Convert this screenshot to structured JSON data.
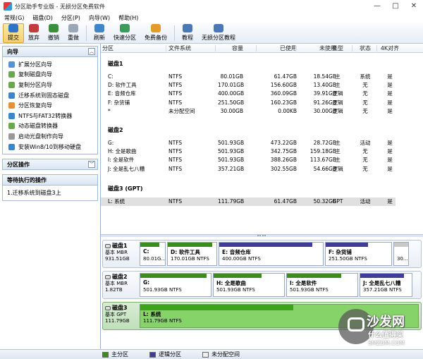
{
  "window": {
    "title": "分区助手专业版 - 无损分区免费软件",
    "controls": [
      "—",
      "□",
      "✕"
    ]
  },
  "menu": [
    "常规(G)",
    "磁盘(D)",
    "分区(P)",
    "向导(W)",
    "帮助(H)"
  ],
  "toolbar": [
    {
      "label": "提交",
      "icon": "commit-icon",
      "color": "#2d73c9",
      "active": true
    },
    {
      "label": "放弃",
      "icon": "discard-icon",
      "color": "#c33c3c"
    },
    {
      "label": "撤销",
      "icon": "undo-icon",
      "color": "#3a8f3a"
    },
    {
      "label": "重做",
      "icon": "redo-icon",
      "color": "#9aa7b8"
    },
    {
      "label": "刷新",
      "icon": "refresh-icon",
      "color": "#3f86c9"
    },
    {
      "label": "快速分区",
      "icon": "quick-partition-icon",
      "color": "#3c9a5b"
    },
    {
      "label": "免费备份",
      "icon": "backup-icon",
      "color": "#e39b2b"
    },
    {
      "label": "教程",
      "icon": "tutorial-icon",
      "color": "#4a78b6"
    },
    {
      "label": "无损分区教程",
      "icon": "lossless-tutorial-icon",
      "color": "#4a78b6"
    }
  ],
  "sidebar": {
    "wizard_title": "向导",
    "wizards": [
      {
        "label": "扩展分区向导",
        "color": "#5a8fd0"
      },
      {
        "label": "复制磁盘向导",
        "color": "#6aa84f"
      },
      {
        "label": "复制分区向导",
        "color": "#6aa84f"
      },
      {
        "label": "迁移系统到固态磁盘",
        "color": "#3d85c6"
      },
      {
        "label": "分区恢复向导",
        "color": "#e69138"
      },
      {
        "label": "NTFS与FAT32转换器",
        "color": "#3d85c6"
      },
      {
        "label": "动态磁盘转换器",
        "color": "#6aa84f"
      },
      {
        "label": "启动光盘制作向导",
        "color": "#999999"
      },
      {
        "label": "安装Win8/10到移动硬盘",
        "color": "#3d85c6"
      }
    ],
    "ops_title": "分区操作",
    "pending_title": "等待执行的操作",
    "pending_items": [
      "1.迁移系统到磁盘3上"
    ]
  },
  "table": {
    "columns": [
      "分区",
      "文件系统",
      "容量",
      "已使用",
      "未使用",
      "类型",
      "状态",
      "4K对齐"
    ],
    "disks": [
      {
        "title": "磁盘1",
        "rows": [
          [
            "C:",
            "NTFS",
            "80.01GB",
            "61.47GB",
            "18.54GB",
            "主",
            "系统",
            "是"
          ],
          [
            "D: 软件工具",
            "NTFS",
            "170.01GB",
            "156.60GB",
            "13.40GB",
            "主",
            "无",
            "是"
          ],
          [
            "E: 音频仓库",
            "NTFS",
            "400.00GB",
            "360.09GB",
            "39.91GB",
            "逻辑",
            "无",
            "是"
          ],
          [
            "F: 杂货铺",
            "NTFS",
            "251.50GB",
            "160.23GB",
            "91.26GB",
            "逻辑",
            "无",
            "是"
          ],
          [
            "*",
            "未分配空间",
            "30.00GB",
            "0.00KB",
            "30.00GB",
            "逻辑",
            "无",
            "是"
          ]
        ]
      },
      {
        "title": "磁盘2",
        "rows": [
          [
            "G:",
            "NTFS",
            "501.93GB",
            "473.22GB",
            "28.72GB",
            "主",
            "活动",
            "是"
          ],
          [
            "H: 全是歌曲",
            "NTFS",
            "501.93GB",
            "342.75GB",
            "159.18GB",
            "主",
            "无",
            "是"
          ],
          [
            "I: 全是软件",
            "NTFS",
            "501.93GB",
            "388.26GB",
            "113.67GB",
            "主",
            "无",
            "是"
          ],
          [
            "J: 全是乱七八糟",
            "NTFS",
            "357.21GB",
            "302.55GB",
            "54.66GB",
            "逻辑",
            "无",
            "是"
          ]
        ]
      },
      {
        "title": "磁盘3 (GPT)",
        "rows": [
          [
            "L: 系统",
            "NTFS",
            "111.79GB",
            "61.47GB",
            "50.32GB",
            "GPT",
            "活动",
            "是"
          ]
        ],
        "selected_row": 0
      }
    ]
  },
  "diskmap": [
    {
      "name": "磁盘1",
      "kind": "基本 MBR",
      "size": "931.51GB",
      "parts": [
        {
          "label": "C:",
          "size": "80.01G...",
          "type": "primary",
          "used": 0.77
        },
        {
          "label": "D: 软件工具",
          "size": "170.01GB NTFS",
          "type": "primary",
          "used": 0.92
        },
        {
          "label": "E: 音频仓库",
          "size": "400.00GB NTFS",
          "type": "logical",
          "used": 0.9
        },
        {
          "label": "F: 杂货铺",
          "size": "251.50GB NTFS",
          "type": "logical",
          "used": 0.64
        },
        {
          "label": "",
          "size": "30...",
          "type": "unalloc",
          "used": 0.0
        }
      ]
    },
    {
      "name": "磁盘2",
      "kind": "基本 MBR",
      "size": "1.82TB",
      "parts": [
        {
          "label": "G:",
          "size": "501.93GB NTFS",
          "type": "primary",
          "used": 0.94
        },
        {
          "label": "H: 全是歌曲",
          "size": "501.93GB NTFS",
          "type": "primary",
          "used": 0.68
        },
        {
          "label": "I: 全是软件",
          "size": "501.93GB NTFS",
          "type": "primary",
          "used": 0.77
        },
        {
          "label": "J: 全是乱七八糟",
          "size": "357.21GB NTFS",
          "type": "logical",
          "used": 0.85
        }
      ]
    },
    {
      "name": "磁盘3",
      "kind": "基本 GPT",
      "size": "111.79GB",
      "selected": true,
      "parts": [
        {
          "label": "L: 系统",
          "size": "111.79GB NTFS",
          "type": "primary",
          "used": 0.55
        }
      ]
    }
  ],
  "legend": [
    {
      "label": "主分区",
      "color": "#3d8b1c"
    },
    {
      "label": "逻辑分区",
      "color": "#3f3c9a"
    },
    {
      "label": "未分配空间",
      "color": "#f0f0f0"
    }
  ],
  "watermark": {
    "title": "沙发网",
    "subtitle": "什么值得买",
    "url": "SMZDM.COM"
  }
}
